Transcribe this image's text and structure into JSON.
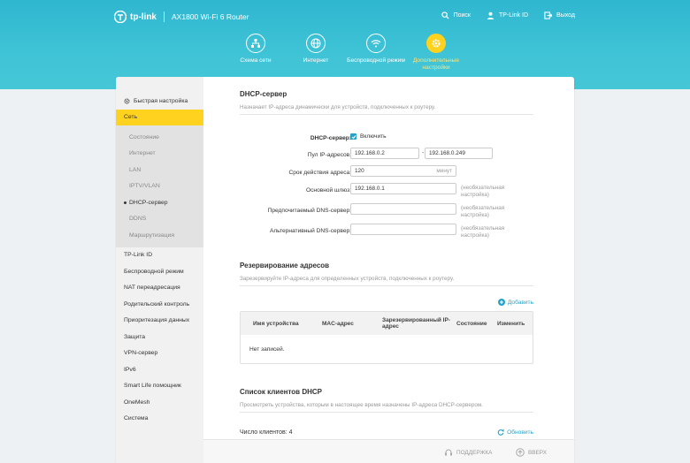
{
  "brand": {
    "logo_text": "tp-link",
    "model": "AX1800 Wi-Fi 6 Router"
  },
  "toplinks": {
    "search": "Поиск",
    "tplink_id": "TP-Link ID",
    "logout": "Выход"
  },
  "nav": {
    "network_map": "Схема сети",
    "internet": "Интернет",
    "wireless": "Беспроводной режим",
    "advanced": "Дополнительные настройки"
  },
  "sidebar": {
    "quick_setup": "Быстрая настройка",
    "network": "Сеть",
    "sub": [
      "Состояние",
      "Интернет",
      "LAN",
      "IPTV/VLAN",
      "DHCP-сервер",
      "DDNS",
      "Маршрутизация"
    ],
    "items": [
      "TP-Link ID",
      "Беспроводной режим",
      "NAT переадресация",
      "Родительский контроль",
      "Приоритезация данных",
      "Защита",
      "VPN-сервер",
      "IPv6",
      "Smart Life помощник",
      "OneMesh",
      "Система"
    ]
  },
  "dhcp": {
    "title": "DHCP-сервер",
    "desc": "Назначает IP-адреса динамически для устройств, подключенных к роутеру.",
    "server_label": "DHCP-сервер:",
    "enable_label": "Включить",
    "pool_label": "Пул IP-адресов:",
    "pool_start": "192.168.0.2",
    "pool_sep": "-",
    "pool_end": "192.168.0.249",
    "lease_label": "Срок действия адреса:",
    "lease_value": "120",
    "lease_unit": "минут",
    "gateway_label": "Основной шлюз:",
    "gateway_value": "192.168.0.1",
    "optional_note": "(необязательная настройка)",
    "dns1_label": "Предпочитаемый DNS-сервер:",
    "dns2_label": "Альтернативный DNS-сервер:"
  },
  "reservation": {
    "title": "Резервирование адресов",
    "desc": "Зарезервируйте IP-адреса для определенных устройств, подключенных к роутеру.",
    "add": "Добавить",
    "columns": [
      "Имя устройства",
      "MAC-адрес",
      "Зарезервированный IP-адрес",
      "Состояние",
      "Изменить"
    ],
    "empty": "Нет записей."
  },
  "clients": {
    "title": "Список клиентов DHCP",
    "desc": "Просмотреть устройства, которым в настоящее время назначены IP-адреса DHCP-сервером.",
    "count": "Число клиентов: 4",
    "refresh": "Обновить"
  },
  "footer": {
    "support": "ПОДДЕРЖКА",
    "top": "ВВЕРХ"
  },
  "colors": {
    "header": "#3fc3d6",
    "accent": "#ffd21f",
    "link": "#25a3c7"
  }
}
